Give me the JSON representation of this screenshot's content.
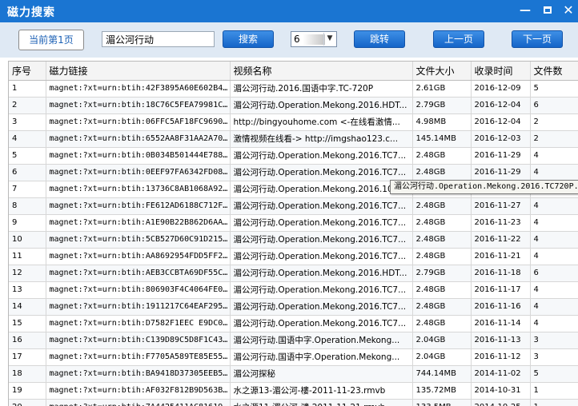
{
  "window": {
    "title": "磁力搜索",
    "min": "—",
    "close": "✕"
  },
  "toolbar": {
    "current_page": "当前第1页",
    "search_value": "湄公河行动",
    "search_button": "搜索",
    "page_select_value": "6",
    "jump_button": "跳转",
    "prev_button": "上一页",
    "next_button": "下一页"
  },
  "table": {
    "columns": [
      "序号",
      "磁力链接",
      "视频名称",
      "文件大小",
      "收录时间",
      "文件数"
    ],
    "rows": [
      [
        "1",
        "magnet:?xt=urn:btih:42F3895A60E602B4...",
        "湄公河行动.2016.国语中字.TC-720P",
        "2.61GB",
        "2016-12-09",
        "5"
      ],
      [
        "2",
        "magnet:?xt=urn:btih:18C76C5FEA79981C...",
        "湄公河行动.Operation.Mekong.2016.HDT...",
        "2.79GB",
        "2016-12-04",
        "6"
      ],
      [
        "3",
        "magnet:?xt=urn:btih:06FFC5AF18FC9690...",
        "http://bingyouhome.com <-在线看激情...",
        "4.98MB",
        "2016-12-04",
        "2"
      ],
      [
        "4",
        "magnet:?xt=urn:btih:6552AA8F31AA2A70...",
        "激情视频在线看-> http://imgshao123.c...",
        "145.14MB",
        "2016-12-03",
        "2"
      ],
      [
        "5",
        "magnet:?xt=urn:btih:0B034B501444E788...",
        "湄公河行动.Operation.Mekong.2016.TC7...",
        "2.48GB",
        "2016-11-29",
        "4"
      ],
      [
        "6",
        "magnet:?xt=urn:btih:0EEF97FA6342FD08...",
        "湄公河行动.Operation.Mekong.2016.TC7...",
        "2.48GB",
        "2016-11-29",
        "4"
      ],
      [
        "7",
        "magnet:?xt=urn:btih:13736C8AB1068A92...",
        "湄公河行动.Operation.Mekong.2016.106",
        "",
        "",
        ""
      ],
      [
        "8",
        "magnet:?xt=urn:btih:FE612AD6188C712F...",
        "湄公河行动.Operation.Mekong.2016.TC7...",
        "2.48GB",
        "2016-11-27",
        "4"
      ],
      [
        "9",
        "magnet:?xt=urn:btih:A1E90B22B862D6AA...",
        "湄公河行动.Operation.Mekong.2016.TC7...",
        "2.48GB",
        "2016-11-23",
        "4"
      ],
      [
        "10",
        "magnet:?xt=urn:btih:5CB527D60C91D215...",
        "湄公河行动.Operation.Mekong.2016.TC7...",
        "2.48GB",
        "2016-11-22",
        "4"
      ],
      [
        "11",
        "magnet:?xt=urn:btih:AA8692954FDD5FF2...",
        "湄公河行动.Operation.Mekong.2016.TC7...",
        "2.48GB",
        "2016-11-21",
        "4"
      ],
      [
        "12",
        "magnet:?xt=urn:btih:AEB3CCBTA69DF55C...",
        "湄公河行动.Operation.Mekong.2016.HDT...",
        "2.79GB",
        "2016-11-18",
        "6"
      ],
      [
        "13",
        "magnet:?xt=urn:btih:806903F4C4064FE0...",
        "湄公河行动.Operation.Mekong.2016.TC7...",
        "2.48GB",
        "2016-11-17",
        "4"
      ],
      [
        "14",
        "magnet:?xt=urn:btih:1911217C64EAF295...",
        "湄公河行动.Operation.Mekong.2016.TC7...",
        "2.48GB",
        "2016-11-16",
        "4"
      ],
      [
        "15",
        "magnet:?xt=urn:btih:D7582F1EEC E9DC01...",
        "湄公河行动.Operation.Mekong.2016.TC7...",
        "2.48GB",
        "2016-11-14",
        "4"
      ],
      [
        "16",
        "magnet:?xt=urn:btih:C139D89C5D8F1C43...",
        "湄公河行动.国语中字.Operation.Mekong...",
        "2.04GB",
        "2016-11-13",
        "3"
      ],
      [
        "17",
        "magnet:?xt=urn:btih:F7705A589TE85E55...",
        "湄公河行动.国语中字.Operation.Mekong...",
        "2.04GB",
        "2016-11-12",
        "3"
      ],
      [
        "18",
        "magnet:?xt=urn:btih:BA9418D37305EEB5...",
        "湄公河探秘",
        "744.14MB",
        "2014-11-02",
        "5"
      ],
      [
        "19",
        "magnet:?xt=urn:btih:AF032F812B9D563B...",
        "水之源13-湄公河-樓-2011-11-23.rmvb",
        "135.72MB",
        "2014-10-31",
        "1"
      ],
      [
        "20",
        "magnet:?xt=urn:btih:7A4425411AC81619...",
        "水之源11-湄公河-谴-2011-11-21.rmvb",
        "133.5MB",
        "2014-10-25",
        "1"
      ]
    ]
  },
  "tooltip": {
    "text": "湄公河行动.Operation.Mekong.2016.TC720P.X2"
  }
}
